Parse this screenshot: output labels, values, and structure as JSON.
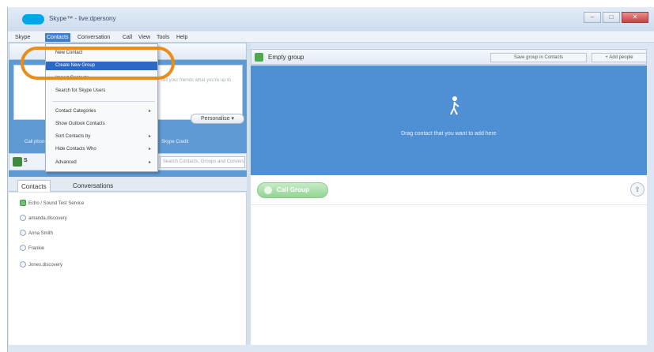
{
  "window": {
    "title": "Skype™ - live:dpersony",
    "controls": {
      "minimize": "–",
      "maximize": "□",
      "close": "✕"
    }
  },
  "menubar": {
    "items": [
      "Skype",
      "Contacts",
      "Conversation",
      "Call",
      "View",
      "Tools",
      "Help"
    ],
    "active": "Contacts"
  },
  "contacts_menu": {
    "items": [
      {
        "label": "New Contact",
        "highlighted": false,
        "submenu": false
      },
      {
        "label": "Create New Group",
        "highlighted": true,
        "submenu": false
      },
      {
        "label": "Import Contacts",
        "highlighted": false,
        "submenu": false
      },
      {
        "label": "Search for Skype Users",
        "highlighted": false,
        "submenu": false
      },
      {
        "label": "Contact Categories",
        "highlighted": false,
        "submenu": true
      },
      {
        "label": "Show Outlook Contacts",
        "highlighted": false,
        "submenu": false
      },
      {
        "label": "Sort Contacts by",
        "highlighted": false,
        "submenu": true
      },
      {
        "label": "Hide Contacts Who",
        "highlighted": false,
        "submenu": true
      },
      {
        "label": "Advanced",
        "highlighted": false,
        "submenu": true
      }
    ],
    "submenu_arrow": "▸"
  },
  "profile": {
    "mood_placeholder": "Tell your friends what you're up to",
    "personalise_label": "Personalise ▾",
    "promo_left": "Call phones",
    "promo_text": "Skype Credit"
  },
  "toolbar": {
    "label": "S",
    "search_placeholder": "Search Contacts, Groups and Conversation Topics"
  },
  "left_tabs": {
    "contacts": "Contacts",
    "conversations": "Conversations"
  },
  "contact_list": [
    {
      "name": "Echo / Sound Test Service",
      "icon": "green"
    },
    {
      "name": "amanda.discovery",
      "icon": "gray"
    },
    {
      "name": "Anna Smith",
      "icon": "gray"
    },
    {
      "name": "Frankie",
      "icon": "gray"
    },
    {
      "name": "Jones.discovery",
      "icon": "gray"
    }
  ],
  "group": {
    "title": "Empty group",
    "save_label": "Save group in Contacts",
    "add_people_label": "+ Add people",
    "drop_hint": "Drag contact that you want to add here",
    "call_group_label": "Call Group"
  },
  "colors": {
    "accent": "#2a6ac4",
    "highlight_ring": "#e98d16",
    "drop_zone": "#4f8fd4",
    "call_green": "#95d395"
  }
}
